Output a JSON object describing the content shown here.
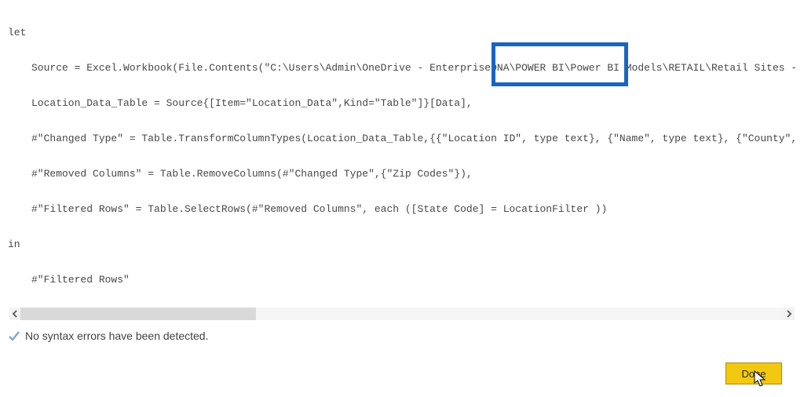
{
  "code": {
    "l1": "let",
    "l2": "Source = Excel.Workbook(File.Contents(\"C:\\Users\\Admin\\OneDrive - EnterpriseDNA\\POWER BI\\Power BI Models\\RETAIL\\Retail Sites - Data",
    "l3": "Location_Data_Table = Source{[Item=\"Location_Data\",Kind=\"Table\"]}[Data],",
    "l4": "#\"Changed Type\" = Table.TransformColumnTypes(Location_Data_Table,{{\"Location ID\", type text}, {\"Name\", type text}, {\"County\", type",
    "l5": "#\"Removed Columns\" = Table.RemoveColumns(#\"Changed Type\",{\"Zip Codes\"}),",
    "l6": "#\"Filtered Rows\" = Table.SelectRows(#\"Removed Columns\", each ([State Code] = LocationFilter ))",
    "l7": "in",
    "l8": "#\"Filtered Rows\""
  },
  "status": {
    "message": "No syntax errors have been detected."
  },
  "buttons": {
    "done": "Done"
  },
  "highlight": {
    "text": "= LocationFilter )"
  }
}
